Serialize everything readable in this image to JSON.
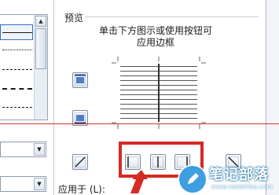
{
  "preview": {
    "group_title": "预览",
    "hint_line1": "单击下方图示或使用按钮可",
    "hint_line2": "应用边框"
  },
  "apply_to": {
    "label": "应用于 (L):"
  },
  "watermark": {
    "title": "笔记部落",
    "url": "www.notetribe.com"
  },
  "colors": {
    "highlight": "#d52a25",
    "red_guide": "#d8342f",
    "watermark_blue": "#3d9ee0"
  },
  "icons": {
    "border_top": "border-top-icon",
    "border_bottom": "border-bottom-icon",
    "border_diag_up": "diagonal-up-icon",
    "border_left": "border-left-icon",
    "border_center": "border-inside-vertical-icon",
    "border_right": "border-right-icon",
    "border_diag_down": "diagonal-down-icon"
  }
}
